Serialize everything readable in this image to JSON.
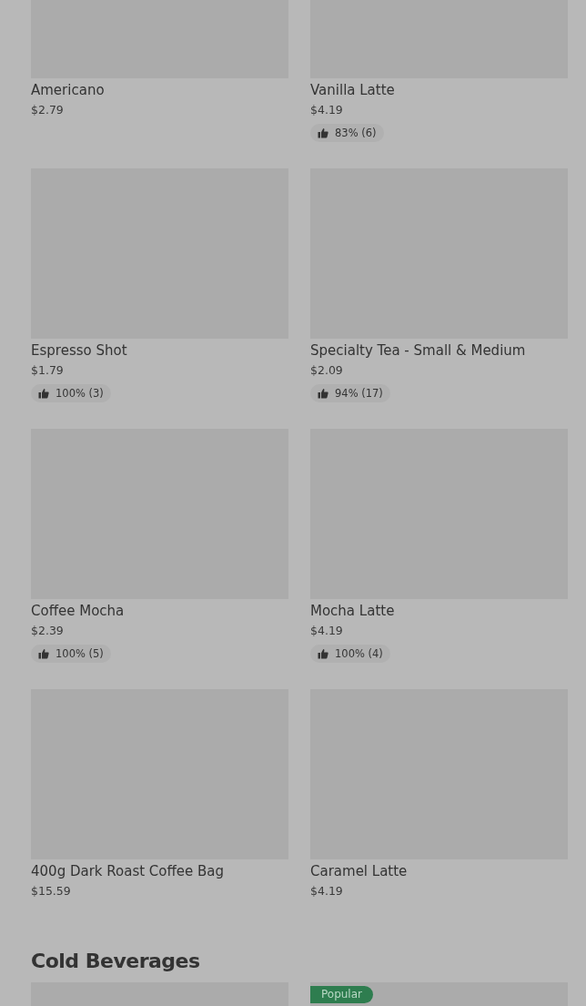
{
  "sections": [
    {
      "items": [
        {
          "name": "Americano",
          "price": "$2.79"
        },
        {
          "name": "Vanilla Latte",
          "price": "$4.19",
          "rating": "83% (6)"
        },
        {
          "name": "Espresso Shot",
          "price": "$1.79",
          "rating": "100% (3)"
        },
        {
          "name": "Specialty Tea - Small & Medium",
          "price": "$2.09",
          "rating": "94% (17)"
        },
        {
          "name": "Coffee Mocha",
          "price": "$2.39",
          "rating": "100% (5)"
        },
        {
          "name": "Mocha Latte",
          "price": "$4.19",
          "rating": "100% (4)"
        },
        {
          "name": "400g Dark Roast Coffee Bag",
          "price": "$15.59"
        },
        {
          "name": "Caramel Latte",
          "price": "$4.19"
        }
      ]
    },
    {
      "title": "Cold Beverages",
      "items": [
        {
          "kind": "picture"
        },
        {
          "kind": "picture",
          "badge": "Popular"
        }
      ]
    }
  ]
}
